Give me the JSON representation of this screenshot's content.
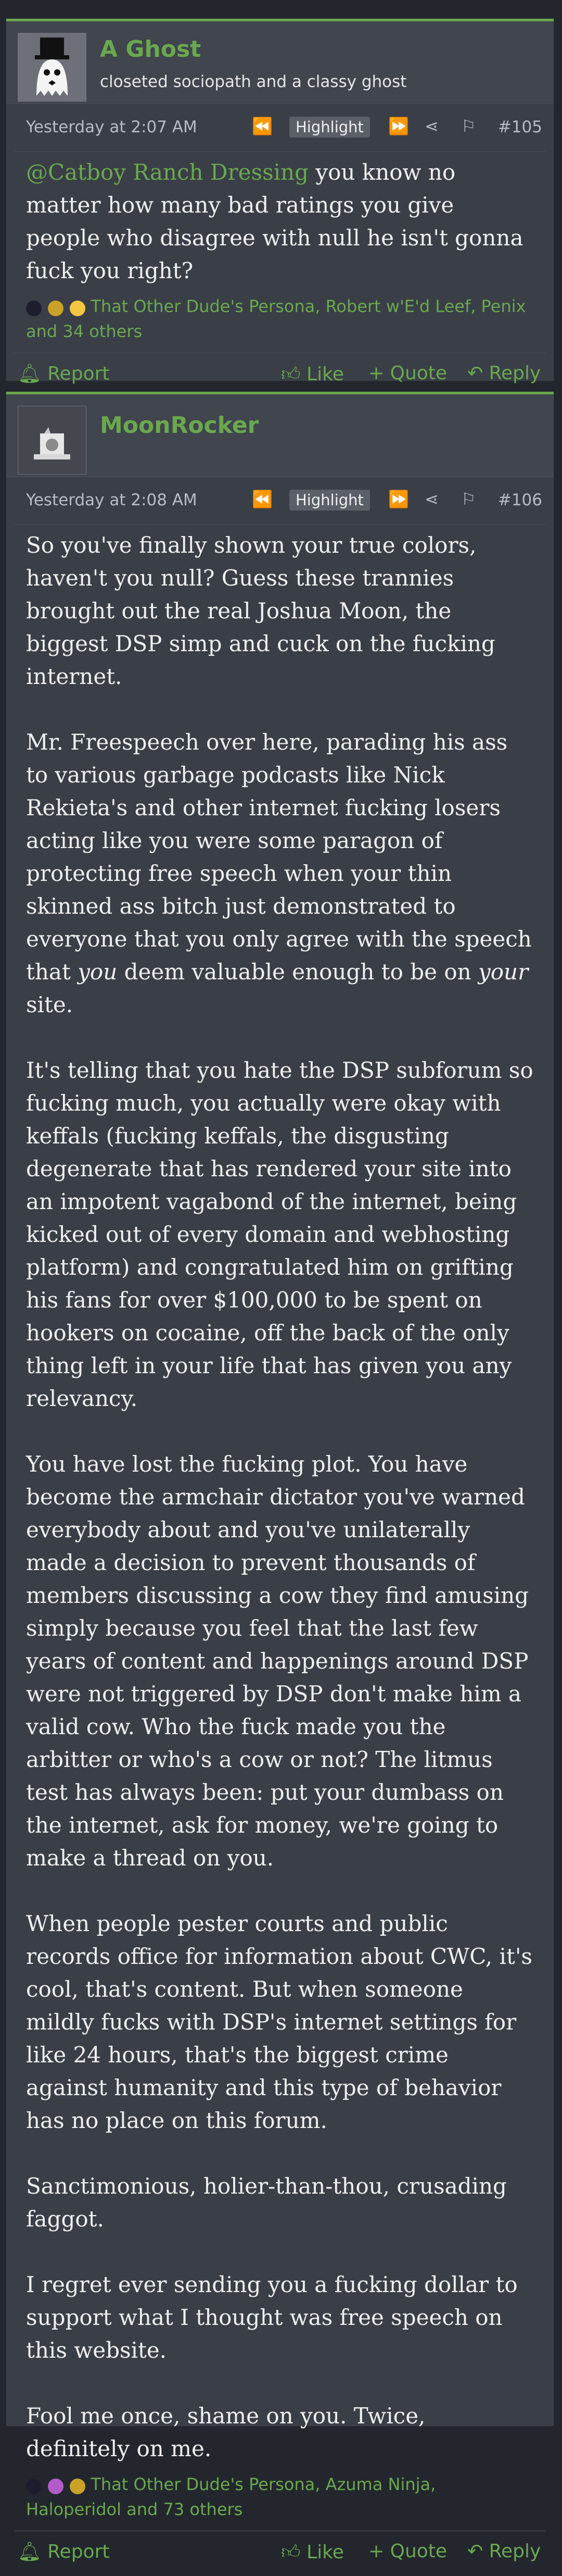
{
  "posts": [
    {
      "username": "A Ghost",
      "user_title": "closeted sociopath and a classy ghost",
      "date": "Yesterday at 2:07 AM",
      "highlight_label": "Highlight",
      "post_number": "#105",
      "mention": "@Catboy Ranch Dressing",
      "body": " you know no matter how many bad ratings you give people who disagree with null he isn't gonna fuck you right?",
      "reactions_text": "That Other Dude's Persona, Robert w'E'd Leef, Penix and 34 others",
      "actions": {
        "report": "Report",
        "like": "Like",
        "quote": "Quote",
        "reply": "Reply"
      }
    },
    {
      "username": "MoonRocker",
      "date": "Yesterday at 2:08 AM",
      "highlight_label": "Highlight",
      "post_number": "#106",
      "paragraphs": [
        "So you've finally shown your true colors, haven't you null? Guess these trannies brought out the real Joshua Moon, the biggest DSP simp and cuck on the fucking internet.",
        "It's telling that you hate the DSP subforum so fucking much, you actually were okay with keffals (fucking keffals, the disgusting degenerate that has rendered your site into an impotent vagabond of the internet, being kicked out of every domain and webhosting platform) and congratulated him on grifting his fans for over $100,000 to be spent on hookers on cocaine, off the back of the only thing left in your life that has given you any relevancy.",
        "You have lost the fucking plot. You have become the armchair dictator you've warned everybody about and you've unilaterally made a decision to prevent thousands of members discussing a cow they find amusing simply because you feel that the last few years of content and happenings around DSP were not triggered by DSP don't make him a valid cow. Who the fuck made you the arbitter or who's a cow or not? The litmus test has always been: put your dumbass on the internet, ask for money, we're going to make a thread on you.",
        "When people pester courts and public records office for information about CWC, it's cool, that's content. But when someone mildly fucks with DSP's internet settings for like 24 hours, that's the biggest crime against humanity and this type of behavior has no place on this forum.",
        "Sanctimonious, holier-than-thou, crusading faggot.",
        "I regret ever sending you a fucking dollar to support what I thought was free speech on this website.",
        "Fool me once, shame on you. Twice, definitely on me."
      ],
      "freespeech_paragraph": {
        "part1": "Mr. Freespeech over here, parading his ass to various garbage podcasts like Nick Rekieta's and other internet fucking losers acting like you were some paragon of protecting free speech when your thin skinned ass bitch just demonstrated to everyone that you only agree with the speech that ",
        "em1": "you",
        "part2": " deem valuable enough to be on ",
        "em2": "your",
        "part3": " site."
      },
      "reactions_text": "That Other Dude's Persona, Azuma Ninja, Haloperidol and 73 others",
      "actions": {
        "report": "Report",
        "like": "Like",
        "quote": "Quote",
        "reply": "Reply"
      }
    }
  ],
  "icons": {
    "prev": "double-left-icon",
    "next": "double-right-icon",
    "share": "share-icon",
    "bookmark": "bookmark-icon",
    "report": "bell-icon",
    "like": "thumbs-up-icon",
    "quote": "plus-icon",
    "reply": "reply-icon"
  },
  "colors": {
    "accent": "#6aa84f",
    "background": "#23272d",
    "post_bg": "#3a3f47"
  }
}
